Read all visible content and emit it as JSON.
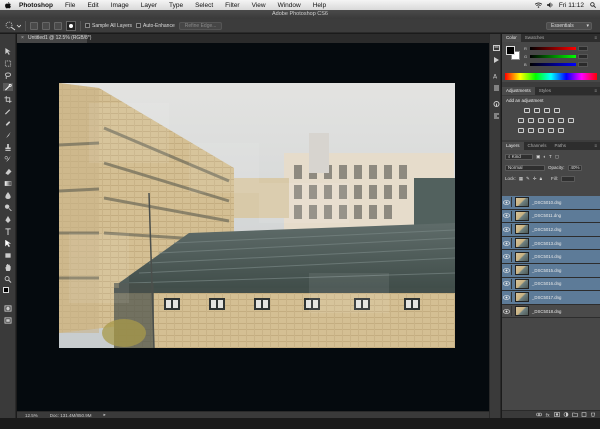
{
  "menubar": {
    "app_name": "Photoshop",
    "menus": [
      "File",
      "Edit",
      "Image",
      "Layer",
      "Type",
      "Select",
      "Filter",
      "View",
      "Window",
      "Help"
    ],
    "clock": "Fri 11:12"
  },
  "window": {
    "title": "Adobe Photoshop CS6"
  },
  "options_bar": {
    "sample_all_layers": "Sample All Layers",
    "auto_enhance": "Auto-Enhance",
    "refine_edge": "Refine Edge...",
    "workspace": "Essentials"
  },
  "document": {
    "tab_label": "Untitled1 @ 12.5% (RGB/8*)",
    "close_glyph": "×"
  },
  "status": {
    "zoom": "12.5%",
    "doc_info": "Doc: 131.4M/850.9M"
  },
  "color_panel": {
    "tabs": [
      "Color",
      "Swatches"
    ],
    "channels": [
      "R",
      "G",
      "B"
    ]
  },
  "adjustments_panel": {
    "tabs": [
      "Adjustments",
      "Styles"
    ],
    "title": "Add an adjustment"
  },
  "layers_panel": {
    "tabs": [
      "Layers",
      "Channels",
      "Paths"
    ],
    "kind_filter": "Kind",
    "blend_mode": "Normal",
    "opacity_label": "Opacity:",
    "opacity_value": "40%",
    "lock_label": "Lock:",
    "fill_label": "Fill:",
    "layers": [
      {
        "name": "_DSC5010.dng",
        "selected": true
      },
      {
        "name": "_DSC5011.dng",
        "selected": true
      },
      {
        "name": "_DSC5012.dng",
        "selected": true
      },
      {
        "name": "_DSC5013.dng",
        "selected": true
      },
      {
        "name": "_DSC5014.dng",
        "selected": true
      },
      {
        "name": "_DSC5015.dng",
        "selected": true
      },
      {
        "name": "_DSC5016.dng",
        "selected": true
      },
      {
        "name": "_DSC5017.dng",
        "selected": true
      },
      {
        "name": "_DSC5018.dng",
        "selected": false
      }
    ]
  },
  "colors": {
    "layer_selected": "#5d7b98",
    "canvas_bg": "#050a0e",
    "ui_dark": "#3c3c3c"
  }
}
